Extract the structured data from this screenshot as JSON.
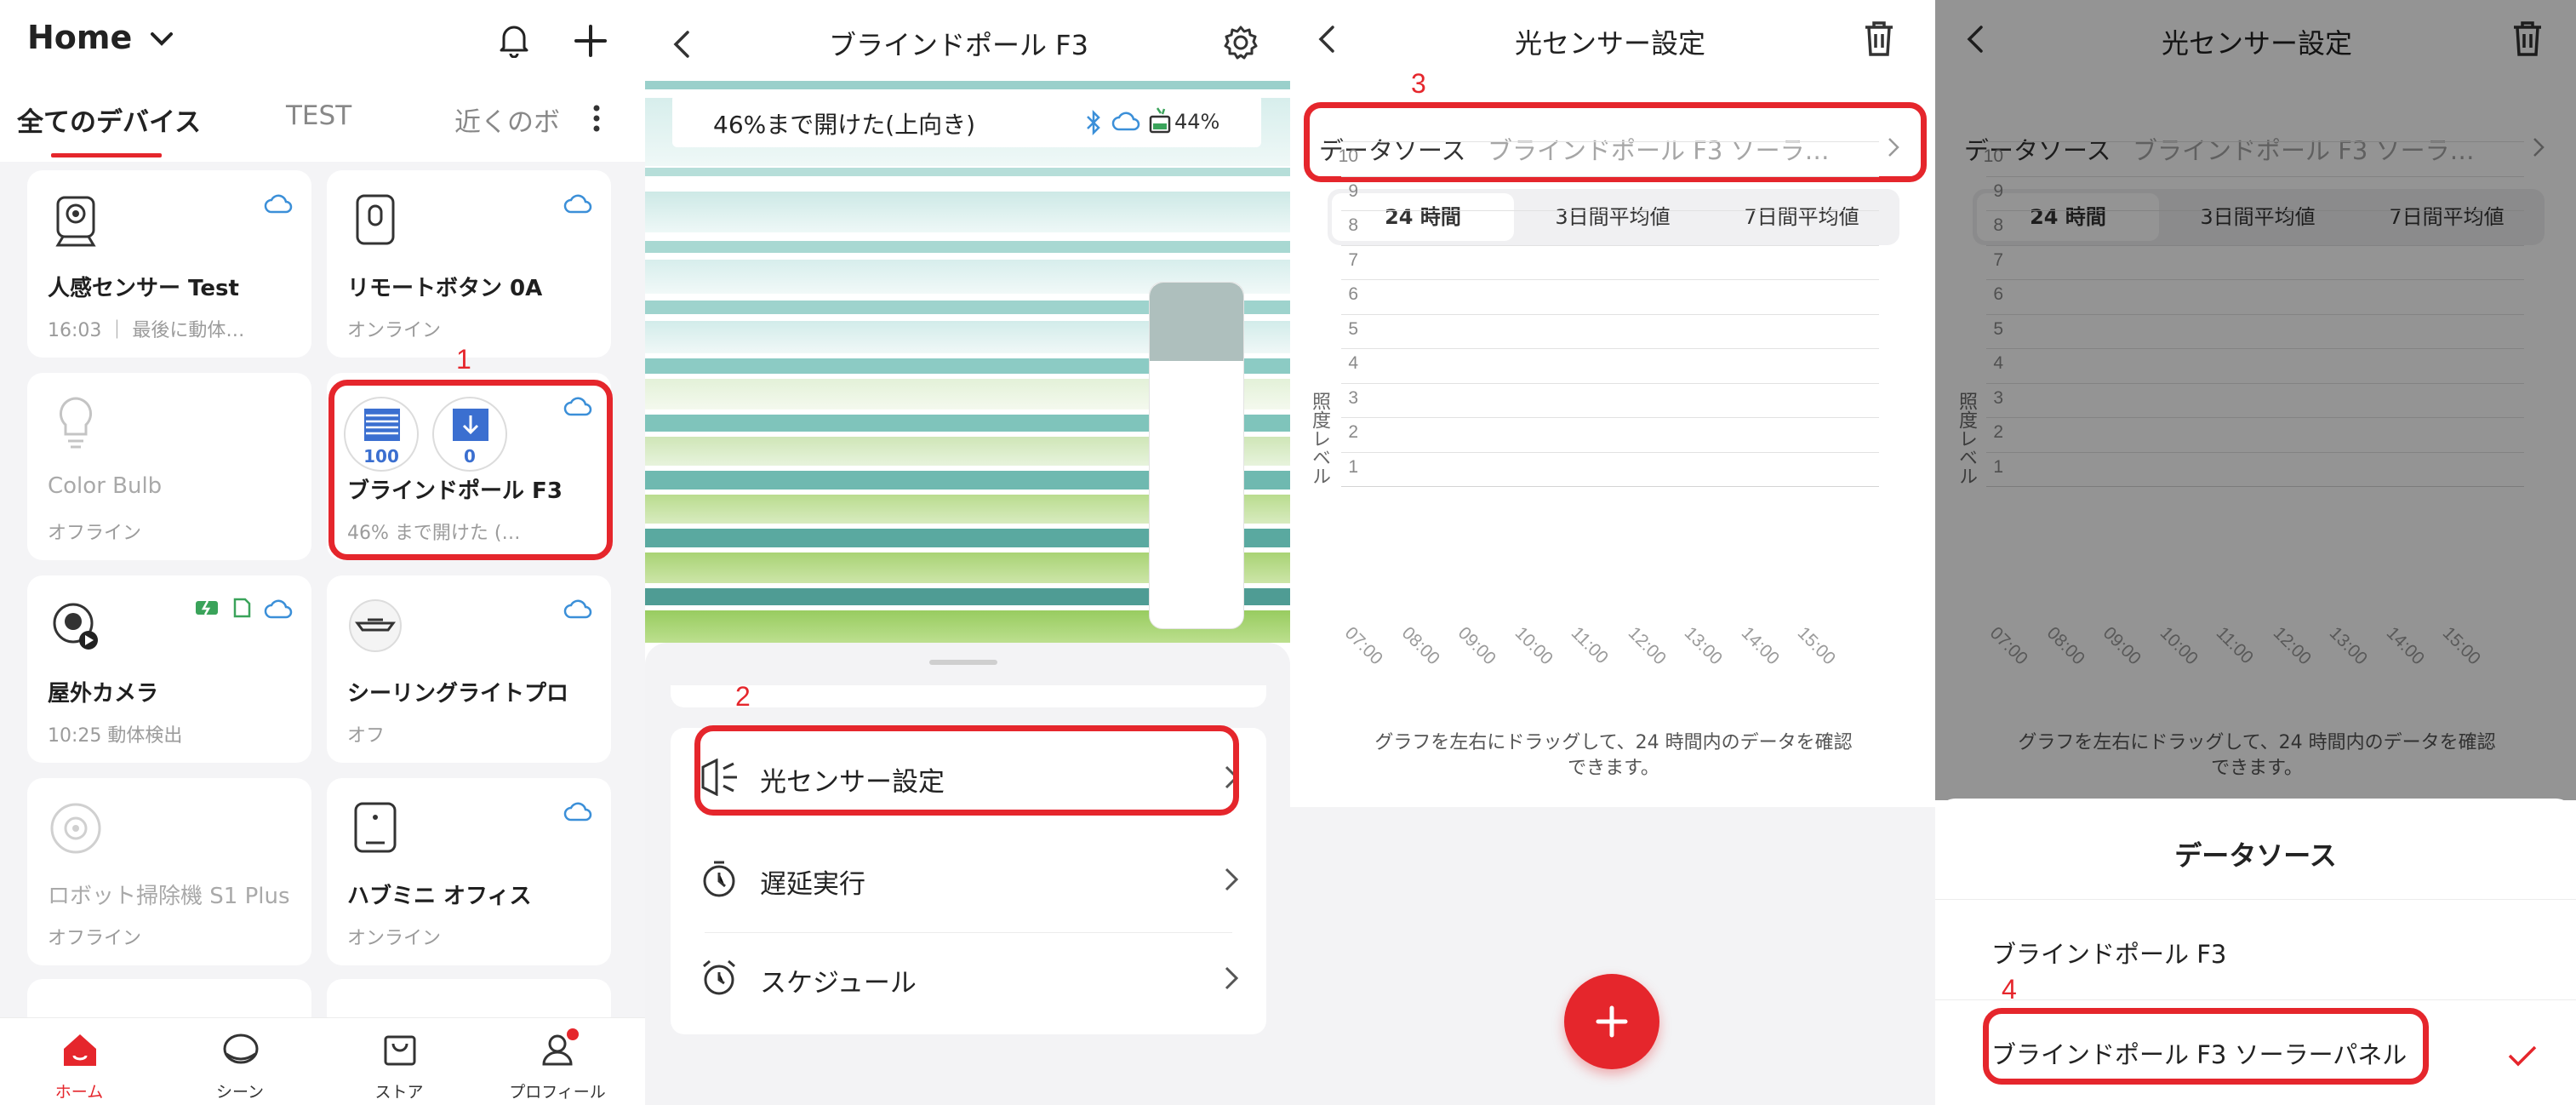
{
  "panel1": {
    "home_title": "Home",
    "tabs": [
      "全てのデバイス",
      "TEST",
      "近くのボ"
    ],
    "devices": [
      {
        "name": "人感センサー Test",
        "status": "16:03 ｜ 最後に動体…",
        "online": true
      },
      {
        "name": "リモートボタン 0A",
        "status": "オンライン",
        "online": true
      },
      {
        "name": "Color Bulb",
        "status": "オフライン",
        "online": false
      },
      {
        "name": "ブラインドポール F3",
        "status": "46% まで開けた (…",
        "online": true,
        "levels": [
          "100",
          "0"
        ]
      },
      {
        "name": "屋外カメラ",
        "status": "10:25 動体検出",
        "online": true
      },
      {
        "name": "シーリングライトプロ",
        "status": "オフ",
        "online": true
      },
      {
        "name": "ロボット掃除機 S1 Plus",
        "status": "オフライン",
        "online": false
      },
      {
        "name": "ハブミニ オフィス",
        "status": "オンライン",
        "online": true
      }
    ],
    "nav": [
      "ホーム",
      "シーン",
      "ストア",
      "プロフィール"
    ],
    "marker": "1"
  },
  "panel2": {
    "title": "ブラインドポール F3",
    "status_text": "46%まで開けた(上向き)",
    "battery": "44%",
    "menu": [
      "光センサー設定",
      "遅延実行",
      "スケジュール"
    ],
    "marker": "2"
  },
  "panel3": {
    "title": "光センサー設定",
    "source_label": "データソース",
    "source_value": "ブラインドポール F3 ソーラ…",
    "segments": [
      "24 時間",
      "3日間平均値",
      "7日間平均値"
    ],
    "note": "グラフを左右にドラッグして、24 時間内のデータを確認できます。",
    "marker": "3",
    "chart_data": {
      "type": "line",
      "ylabel": "照度レベル",
      "y_ticks": [
        "10",
        "9",
        "8",
        "7",
        "6",
        "5",
        "4",
        "3",
        "2",
        "1"
      ],
      "x_ticks": [
        "07:00",
        "08:00",
        "09:00",
        "10:00",
        "11:00",
        "12:00",
        "13:00",
        "14:00",
        "15:00"
      ],
      "ylim": [
        1,
        10
      ],
      "series": []
    }
  },
  "panel4": {
    "title": "光センサー設定",
    "source_label": "データソース",
    "source_value": "ブラインドポール F3 ソーラ…",
    "segments": [
      "24 時間",
      "3日間平均値",
      "7日間平均値"
    ],
    "note": "グラフを左右にドラッグして、24 時間内のデータを確認できます。",
    "sheet_title": "データソース",
    "options": [
      "ブラインドポール F3",
      "ブラインドポール F3 ソーラーパネル"
    ],
    "marker": "4"
  },
  "colors": {
    "accent": "#e5262c",
    "link_blue": "#3b8fd8"
  }
}
